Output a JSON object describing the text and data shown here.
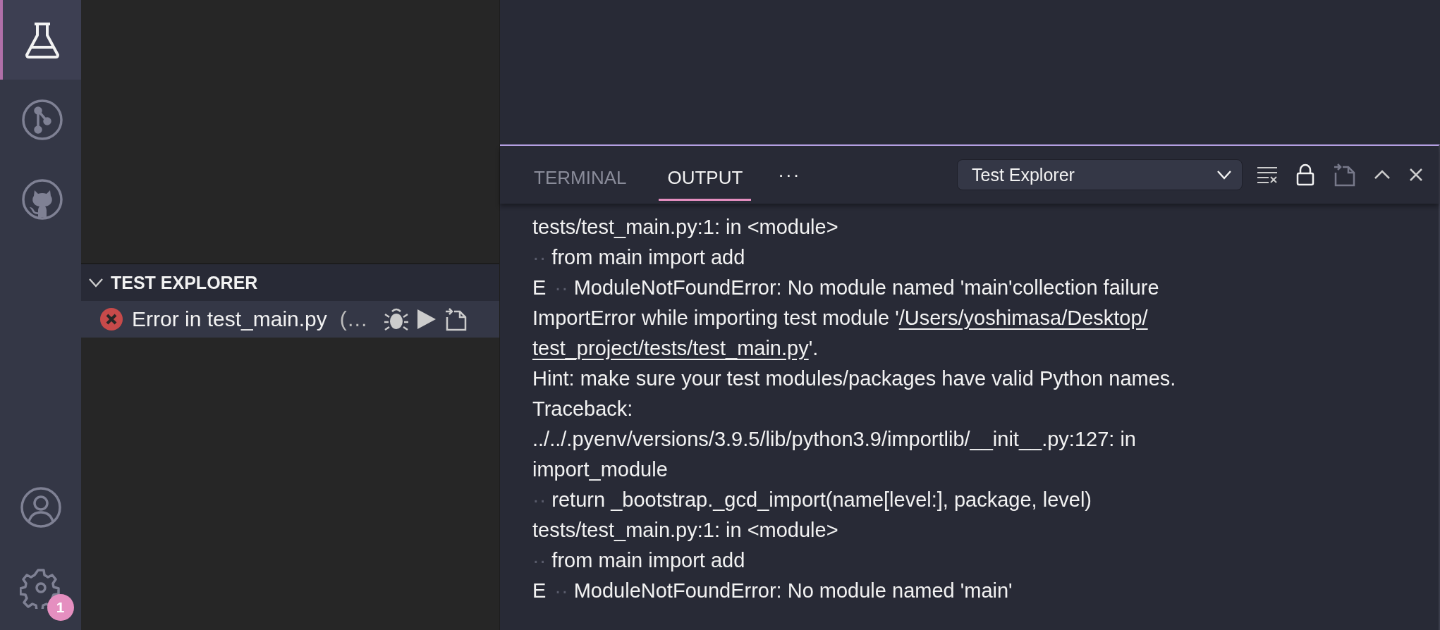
{
  "activity_bar": {
    "items": [
      {
        "kind": "flask",
        "selected": true
      },
      {
        "kind": "branch",
        "selected": false
      },
      {
        "kind": "github",
        "selected": false
      }
    ],
    "bottom": [
      {
        "kind": "account"
      },
      {
        "kind": "gear",
        "badge": "1"
      }
    ]
  },
  "sidebar": {
    "section": {
      "title": "TEST EXPLORER",
      "expanded": true,
      "items": [
        {
          "failed": true,
          "label": "Error in test_main.py",
          "suffix": "(…"
        }
      ]
    }
  },
  "panel": {
    "tabs": [
      {
        "label": "TERMINAL",
        "selected": false
      },
      {
        "label": "OUTPUT",
        "selected": true
      }
    ],
    "more": "···",
    "channel": "Test Explorer",
    "lines": [
      [
        {
          "kind": "plain",
          "text": "tests/test_main.py:1: in <module>"
        }
      ],
      [
        {
          "kind": "marker",
          "text": "··"
        },
        {
          "kind": "plain",
          "text": "from main import add"
        }
      ],
      [
        {
          "kind": "plain",
          "text": "E"
        },
        {
          "kind": "marker",
          "text": "··"
        },
        {
          "kind": "plain",
          "text": "ModuleNotFoundError: No module named 'main'collection failure"
        }
      ],
      [
        {
          "kind": "plain",
          "text": "ImportError while importing test module '"
        },
        {
          "kind": "link",
          "text": "/Users/yoshimasa/Desktop/"
        }
      ],
      [
        {
          "kind": "link",
          "text": "test_project/tests/test_main.py"
        },
        {
          "kind": "plain",
          "text": "'."
        }
      ],
      [
        {
          "kind": "plain",
          "text": "Hint: make sure your test modules/packages have valid Python names."
        }
      ],
      [
        {
          "kind": "plain",
          "text": "Traceback:"
        }
      ],
      [
        {
          "kind": "plain",
          "text": "../../.pyenv/versions/3.9.5/lib/python3.9/importlib/__init__.py:127: in"
        }
      ],
      [
        {
          "kind": "plain",
          "text": "import_module"
        }
      ],
      [
        {
          "kind": "marker",
          "text": "··"
        },
        {
          "kind": "plain",
          "text": "return _bootstrap._gcd_import(name[level:], package, level)"
        }
      ],
      [
        {
          "kind": "plain",
          "text": "tests/test_main.py:1: in <module>"
        }
      ],
      [
        {
          "kind": "marker",
          "text": "··"
        },
        {
          "kind": "plain",
          "text": "from main import add"
        }
      ],
      [
        {
          "kind": "plain",
          "text": "E"
        },
        {
          "kind": "marker",
          "text": "··"
        },
        {
          "kind": "plain",
          "text": "ModuleNotFoundError: No module named 'main'"
        }
      ]
    ]
  }
}
